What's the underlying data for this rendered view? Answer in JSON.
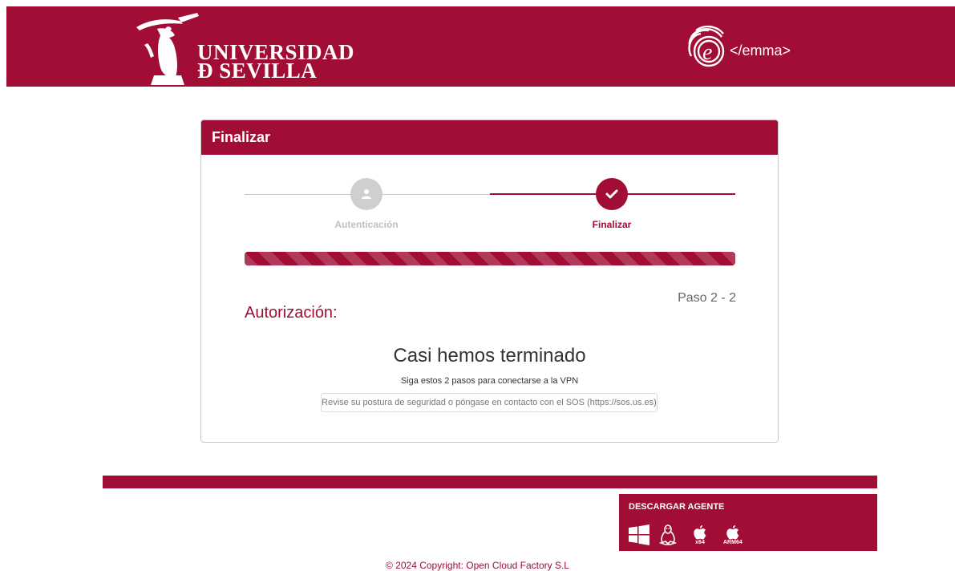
{
  "header": {
    "university_line1": "UNIVERSIDAD",
    "university_line2": "Ð SEVILLA",
    "emma_brand": "</emma>"
  },
  "card": {
    "title": "Finalizar",
    "steps": [
      {
        "label": "Autenticación",
        "state": "inactive",
        "icon": "user-icon"
      },
      {
        "label": "Finalizar",
        "state": "active",
        "icon": "check-icon"
      }
    ],
    "progress_percent": 100,
    "step_indicator": "Paso 2 - 2",
    "section_title": "Autorización:",
    "headline": "Casi hemos terminado",
    "subtext": "Siga estos 2 pasos para conectarse a la VPN",
    "sos_message": "Revise su postura de seguridad o póngase en contacto con el SOS (https://sos.us.es)"
  },
  "footer": {
    "agent_title": "DESCARGAR AGENTE",
    "downloads": [
      {
        "icon": "windows-icon",
        "tag": ""
      },
      {
        "icon": "linux-icon",
        "tag": ""
      },
      {
        "icon": "apple-icon",
        "tag": "x64"
      },
      {
        "icon": "apple-icon",
        "tag": "ARM64"
      }
    ],
    "copyright": "© 2024 Copyright: Open Cloud Factory S.L"
  },
  "colors": {
    "brand": "#a10d34",
    "inactive": "#cfcfcf"
  }
}
